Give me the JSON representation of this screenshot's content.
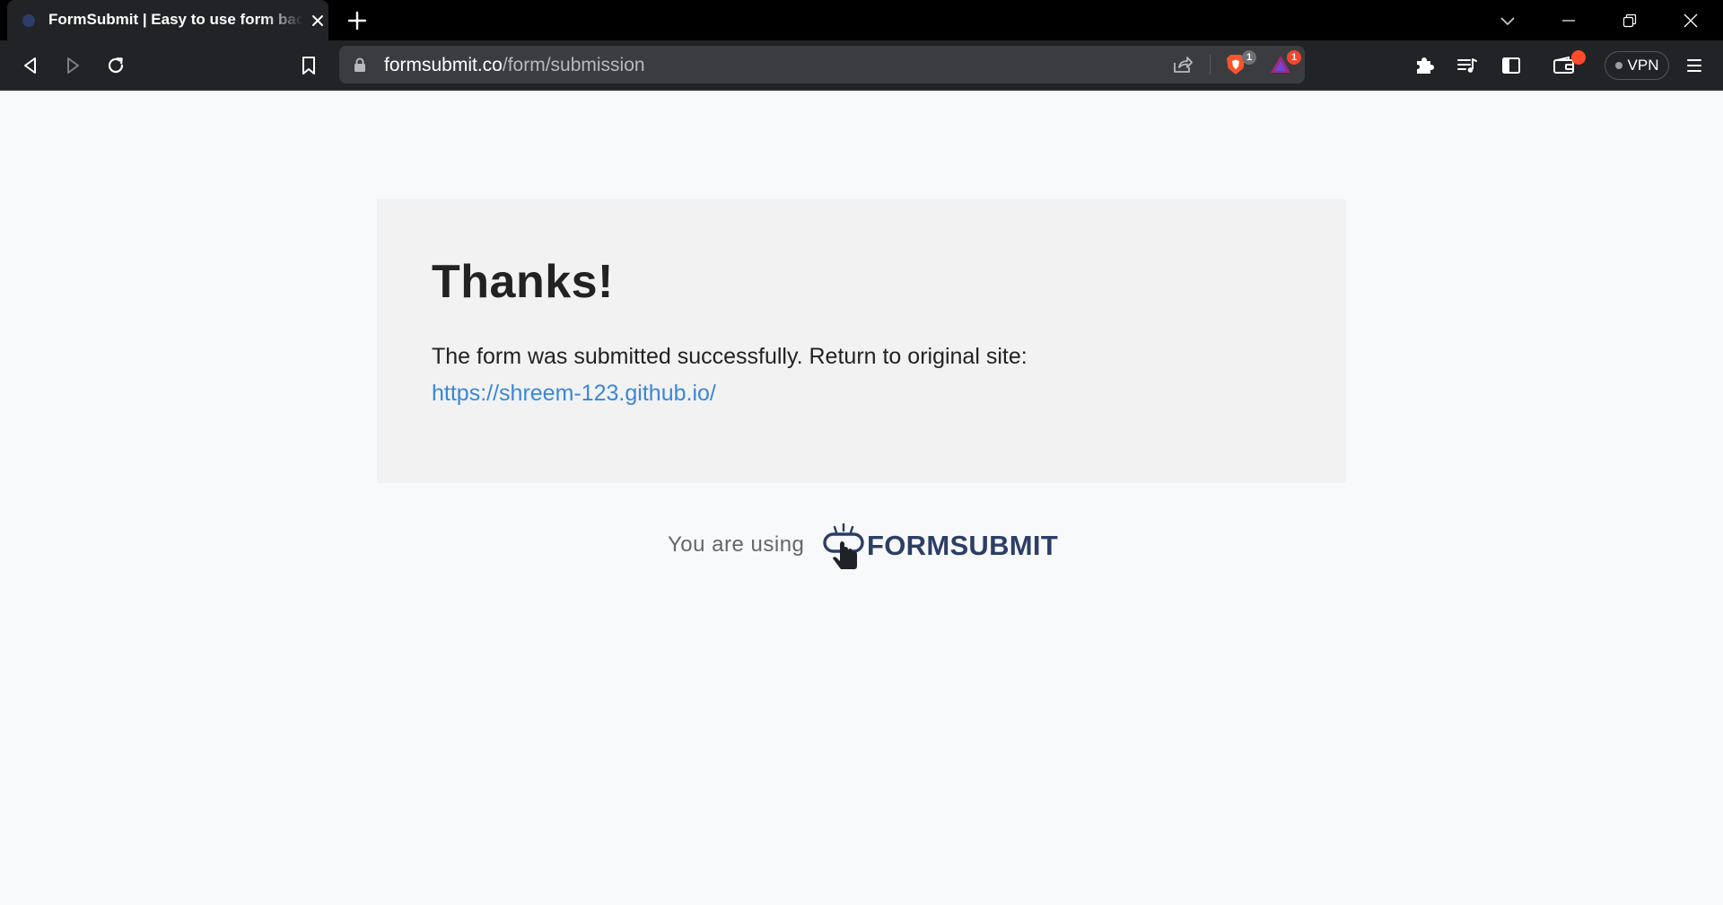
{
  "browser": {
    "tab": {
      "title": "FormSubmit | Easy to use form backend"
    },
    "omnibox": {
      "url_host": "formsubmit.co",
      "url_path": "/form/submission"
    },
    "shields_count": "1",
    "rewards_count": "1",
    "vpn_label": "VPN",
    "colors": {
      "frame": "#000000",
      "toolbar": "#222326",
      "omnibox": "#3b3c40",
      "badge": "#f0462e"
    }
  },
  "page": {
    "heading": "Thanks!",
    "message": "The form was submitted successfully. Return to original site:",
    "return_link": "https://shreem-123.github.io/",
    "footer_label": "You are using",
    "brand_name": "FORMSUBMIT",
    "colors": {
      "background": "#f8f9fa",
      "card": "#f2f2f2",
      "link": "#3a87d9",
      "brand": "#2c3e66"
    }
  }
}
